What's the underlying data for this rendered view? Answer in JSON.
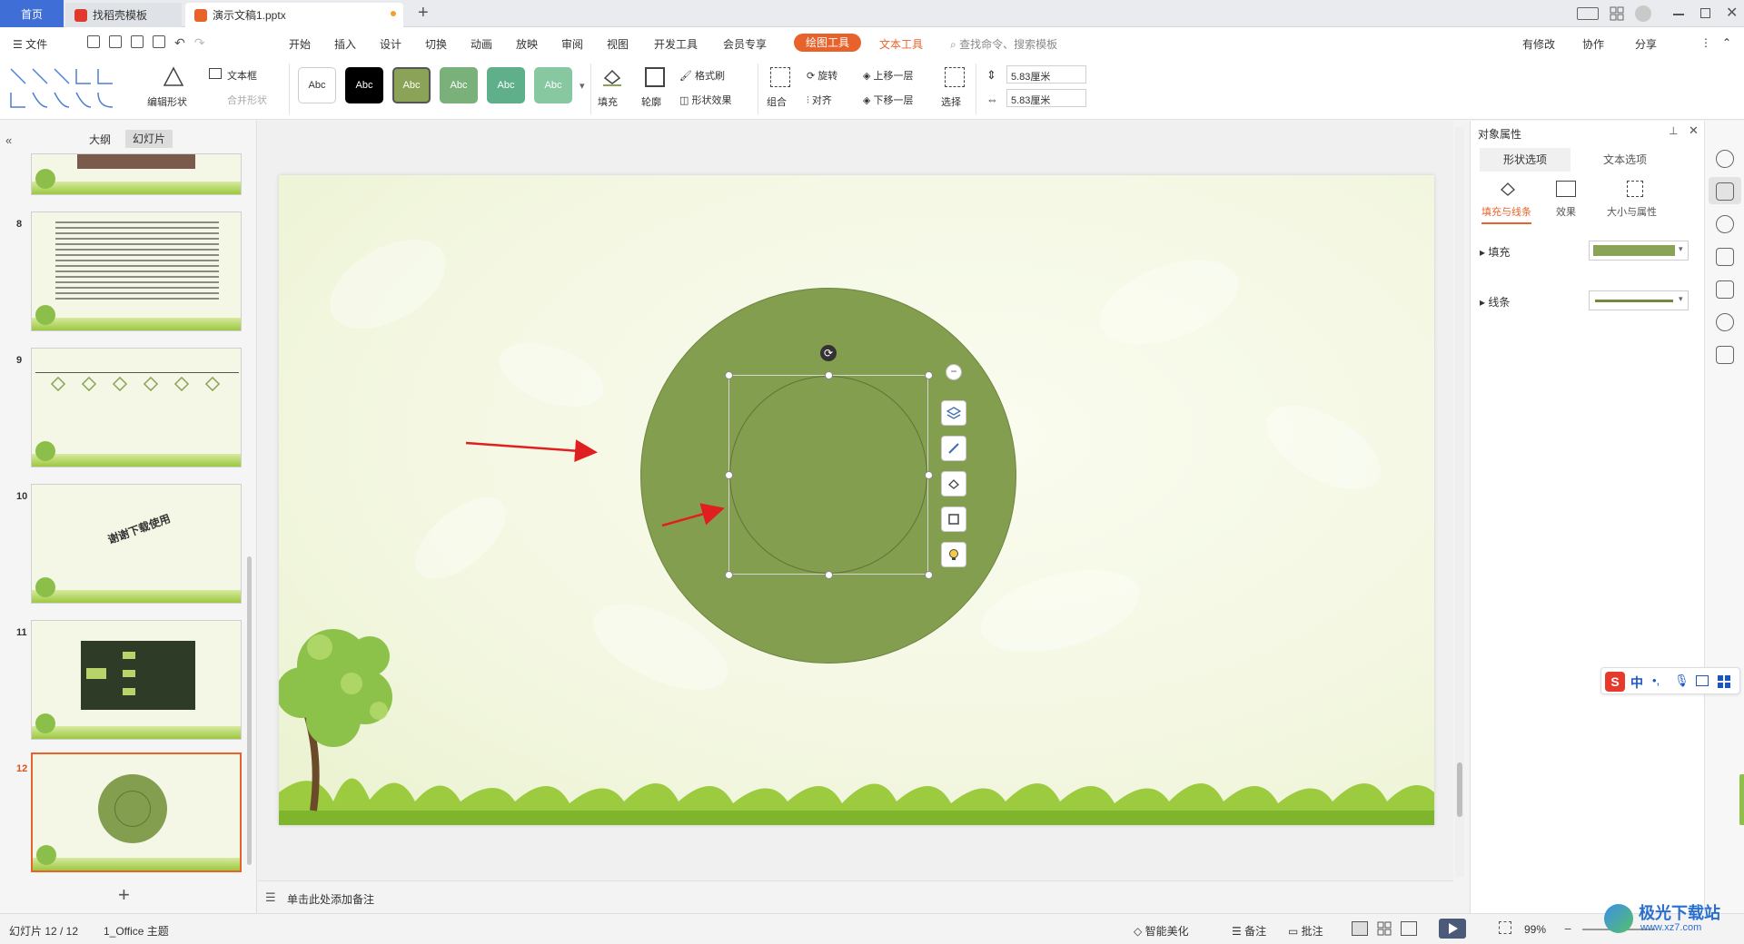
{
  "tabs": {
    "home": "首页",
    "template": "找稻壳模板",
    "document": "演示文稿1.pptx",
    "new_tab": "+"
  },
  "menu": {
    "file": "文件",
    "items": [
      "开始",
      "插入",
      "设计",
      "切换",
      "动画",
      "放映",
      "审阅",
      "视图",
      "开发工具",
      "会员专享"
    ],
    "drawing_tools": "绘图工具",
    "text_tools": "文本工具",
    "search_placeholder": "查找命令、搜索模板",
    "has_changes": "有修改",
    "collaborate": "协作",
    "share": "分享"
  },
  "ribbon": {
    "edit_shape": "编辑形状",
    "text_box": "文本框",
    "merge_shape": "合并形状",
    "style_label": "Abc",
    "fill": "填充",
    "outline": "轮廓",
    "format_painter": "格式刷",
    "shape_effect": "形状效果",
    "group": "组合",
    "rotate": "旋转",
    "align": "对齐",
    "bring_forward": "上移一层",
    "send_backward": "下移一层",
    "select": "选择",
    "height": "5.83厘米",
    "width": "5.83厘米"
  },
  "left_panel": {
    "outline_tab": "大纲",
    "slides_tab": "幻灯片",
    "slide_numbers": [
      "8",
      "9",
      "10",
      "11",
      "12"
    ],
    "slide10_text": "谢谢下载使用"
  },
  "notes_placeholder": "单击此处添加备注",
  "right_panel": {
    "title": "对象属性",
    "tab_shape": "形状选项",
    "tab_text": "文本选项",
    "sub_fill_line": "填充与线条",
    "sub_effect": "效果",
    "sub_size": "大小与属性",
    "fill_label": "填充",
    "line_label": "线条",
    "fill_color": "#8aa356",
    "line_color": "#6f8a3a"
  },
  "status": {
    "slide_counter": "幻灯片 12 / 12",
    "theme": "1_Office 主题",
    "smart_beautify": "智能美化",
    "notes": "备注",
    "comments": "批注",
    "zoom": "99%"
  },
  "ime": {
    "lang": "中"
  },
  "watermark": {
    "site": "极光下载站",
    "url": "www.xz7.com"
  },
  "colors": {
    "accent_blue": "#3f6fd6",
    "drawing_tab": "#e8632b",
    "circle_outer": "#849e4f",
    "arrow_red": "#e02020"
  }
}
